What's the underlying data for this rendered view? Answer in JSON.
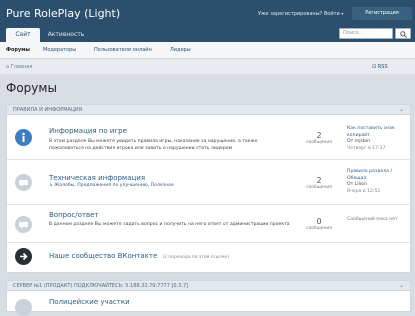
{
  "header": {
    "logo": "Pure RolePlay (Light)",
    "login_prompt": "Уже зарегистрированы? Войти",
    "register_button": "Регистрация",
    "tabs": [
      "Сайт",
      "Активность"
    ],
    "search_placeholder": "Поиск..."
  },
  "subnav": [
    "Форумы",
    "Модераторы",
    "Пользователи онлайн",
    "Лидеры"
  ],
  "breadcrumb": "Главная",
  "rss_label": "RSS",
  "page_title": "Форумы",
  "category1": {
    "title": "ПРАВИЛА И ИНФОРМАЦИЯ",
    "forums": [
      {
        "name": "Информация по игре",
        "desc": "В этом разделе Вы можете увидеть правила игры, наказания за нарушение, а также пожаловаться на действия игрока или завить о нарушении стать лидером",
        "count": "2",
        "count_label": "сообщения",
        "last_title": "Как поставить знак копирайт.",
        "last_by": "От mjsbin",
        "last_time": "Четверг в 17:37"
      },
      {
        "name": "Техническая информация",
        "subforums": "Жалобы, Предложения по улучшению, Полезное",
        "count": "2",
        "count_label": "сообщения",
        "last_title": "Правила раздела / Обещал.",
        "last_by": "От Lilion",
        "last_time": "Вчера в 12:52"
      },
      {
        "name": "Вопрос/ответ",
        "desc": "В данном разделе Вы можете задать вопрос и получить на него ответ от администрации проекта",
        "count": "0",
        "count_label": "сообщения",
        "last_title": "Сообщений пока нет"
      },
      {
        "name": "Наше сообщество ВКонтакте",
        "note": "(2 перехода по этой ссылке)"
      }
    ]
  },
  "category2": {
    "title": "СЕРВЕР №1 (ПРОДАКТ) ПОДКЛЮЧАЙТЕСЬ: 5.188.32.79:7777 [0.3.7]",
    "forums": [
      {
        "name": "Полицейские участки"
      }
    ]
  },
  "colors": {
    "header": "#2c4f6e",
    "accent": "#2c5d86",
    "read_icon": "#c9d2db",
    "unread_icon": "#3d7ec2"
  }
}
